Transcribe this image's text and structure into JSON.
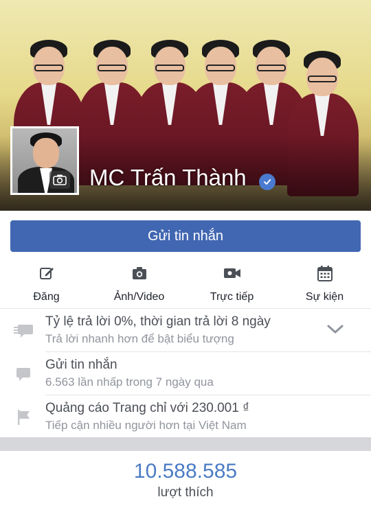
{
  "header": {
    "page_name": "MC Trấn Thành",
    "verified_icon": "verified-badge-icon",
    "camera_icon": "camera-icon"
  },
  "primary_action": {
    "label": "Gửi tin nhắn",
    "color": "#4267b2"
  },
  "actions": [
    {
      "label": "Đăng",
      "icon": "compose-icon"
    },
    {
      "label": "Ảnh/Video",
      "icon": "camera-icon"
    },
    {
      "label": "Trực tiếp",
      "icon": "live-video-icon"
    },
    {
      "label": "Sự kiện",
      "icon": "calendar-icon"
    }
  ],
  "info": [
    {
      "title": "Tỷ lệ trả lời 0%, thời gian trả lời 8 ngày",
      "subtitle": "Trả lời nhanh hơn để bật biểu tượng",
      "icon": "speech-bubbles-icon"
    },
    {
      "title": "Gửi tin nhắn",
      "subtitle": "6.563 lần nhấp trong 7 ngày qua",
      "icon": "message-bubble-icon"
    },
    {
      "title": "Quảng cáo Trang chỉ với 230.001 ₫",
      "subtitle": "Tiếp cận nhiều người hơn tại Việt Nam",
      "icon": "flag-icon"
    }
  ],
  "likes": {
    "count": "10.588.585",
    "label": "lượt thích",
    "count_color": "#4a7bc4"
  }
}
